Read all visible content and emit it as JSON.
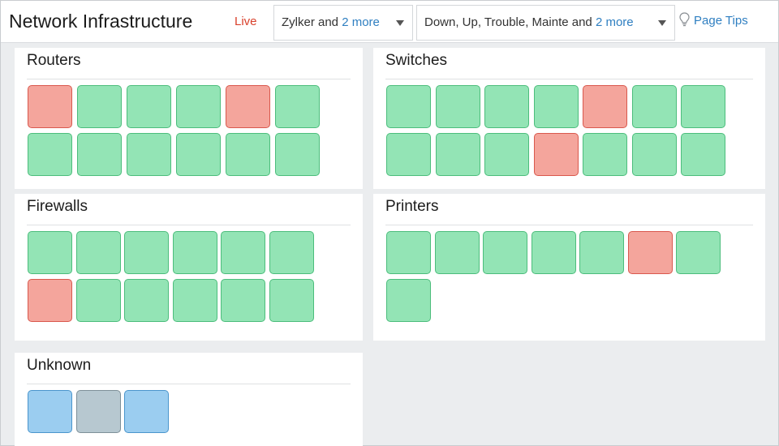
{
  "header": {
    "title": "Network Infrastructure",
    "live_label": "Live",
    "filter_accounts": {
      "text": "Zylker and ",
      "more": "2 more"
    },
    "filter_status": {
      "text": "Down, Up, Trouble, Mainte and ",
      "more": "2 more"
    },
    "page_tips_label": "Page Tips",
    "page_tips_icon": "lightbulb-icon"
  },
  "status_colors": {
    "up": "#93e4b5",
    "down": "#f4a59c",
    "unmanaged": "#9bcdf0",
    "unknown": "#b7c8d0"
  },
  "panels": [
    {
      "id": "routers",
      "title": "Routers",
      "columns": 6,
      "step_x": 61,
      "step_y": 59,
      "tiles": [
        "down",
        "up",
        "up",
        "up",
        "down",
        "up",
        "up",
        "up",
        "up",
        "up",
        "up",
        "up"
      ]
    },
    {
      "id": "switches",
      "title": "Switches",
      "columns": 7,
      "step_x": 60.5,
      "step_y": 59,
      "tiles": [
        "up",
        "up",
        "up",
        "up",
        "down",
        "up",
        "up",
        "up",
        "up",
        "up",
        "down",
        "up",
        "up",
        "up"
      ]
    },
    {
      "id": "firewalls",
      "title": "Firewalls",
      "columns": 6,
      "step_x": 59.5,
      "step_y": 59,
      "tiles": [
        "up",
        "up",
        "up",
        "up",
        "up",
        "up",
        "down",
        "up",
        "up",
        "up",
        "up",
        "up"
      ]
    },
    {
      "id": "printers",
      "title": "Printers",
      "columns": 7,
      "step_x": 59.5,
      "step_y": 59,
      "tiles": [
        "up",
        "up",
        "up",
        "up",
        "up",
        "down",
        "up",
        "up"
      ]
    },
    {
      "id": "unknown",
      "title": "Unknown",
      "columns": 6,
      "step_x": 59.5,
      "step_y": 59,
      "tiles": [
        "unmanaged",
        "unknown",
        "unmanaged"
      ]
    }
  ]
}
